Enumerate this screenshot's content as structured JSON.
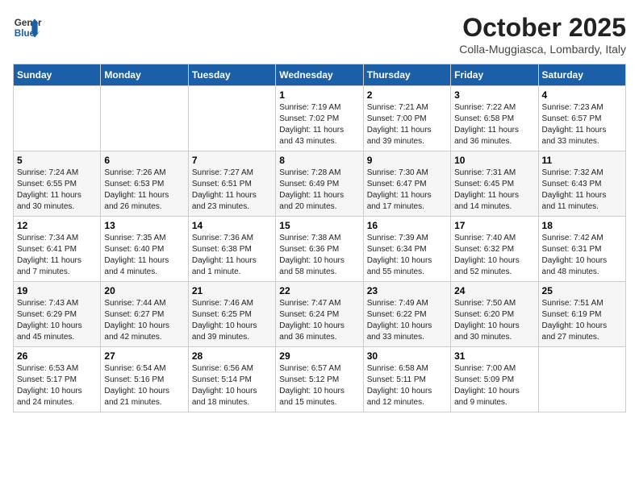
{
  "header": {
    "logo_line1": "General",
    "logo_line2": "Blue",
    "month": "October 2025",
    "location": "Colla-Muggiasca, Lombardy, Italy"
  },
  "weekdays": [
    "Sunday",
    "Monday",
    "Tuesday",
    "Wednesday",
    "Thursday",
    "Friday",
    "Saturday"
  ],
  "weeks": [
    [
      {
        "day": "",
        "info": ""
      },
      {
        "day": "",
        "info": ""
      },
      {
        "day": "",
        "info": ""
      },
      {
        "day": "1",
        "info": "Sunrise: 7:19 AM\nSunset: 7:02 PM\nDaylight: 11 hours\nand 43 minutes."
      },
      {
        "day": "2",
        "info": "Sunrise: 7:21 AM\nSunset: 7:00 PM\nDaylight: 11 hours\nand 39 minutes."
      },
      {
        "day": "3",
        "info": "Sunrise: 7:22 AM\nSunset: 6:58 PM\nDaylight: 11 hours\nand 36 minutes."
      },
      {
        "day": "4",
        "info": "Sunrise: 7:23 AM\nSunset: 6:57 PM\nDaylight: 11 hours\nand 33 minutes."
      }
    ],
    [
      {
        "day": "5",
        "info": "Sunrise: 7:24 AM\nSunset: 6:55 PM\nDaylight: 11 hours\nand 30 minutes."
      },
      {
        "day": "6",
        "info": "Sunrise: 7:26 AM\nSunset: 6:53 PM\nDaylight: 11 hours\nand 26 minutes."
      },
      {
        "day": "7",
        "info": "Sunrise: 7:27 AM\nSunset: 6:51 PM\nDaylight: 11 hours\nand 23 minutes."
      },
      {
        "day": "8",
        "info": "Sunrise: 7:28 AM\nSunset: 6:49 PM\nDaylight: 11 hours\nand 20 minutes."
      },
      {
        "day": "9",
        "info": "Sunrise: 7:30 AM\nSunset: 6:47 PM\nDaylight: 11 hours\nand 17 minutes."
      },
      {
        "day": "10",
        "info": "Sunrise: 7:31 AM\nSunset: 6:45 PM\nDaylight: 11 hours\nand 14 minutes."
      },
      {
        "day": "11",
        "info": "Sunrise: 7:32 AM\nSunset: 6:43 PM\nDaylight: 11 hours\nand 11 minutes."
      }
    ],
    [
      {
        "day": "12",
        "info": "Sunrise: 7:34 AM\nSunset: 6:41 PM\nDaylight: 11 hours\nand 7 minutes."
      },
      {
        "day": "13",
        "info": "Sunrise: 7:35 AM\nSunset: 6:40 PM\nDaylight: 11 hours\nand 4 minutes."
      },
      {
        "day": "14",
        "info": "Sunrise: 7:36 AM\nSunset: 6:38 PM\nDaylight: 11 hours\nand 1 minute."
      },
      {
        "day": "15",
        "info": "Sunrise: 7:38 AM\nSunset: 6:36 PM\nDaylight: 10 hours\nand 58 minutes."
      },
      {
        "day": "16",
        "info": "Sunrise: 7:39 AM\nSunset: 6:34 PM\nDaylight: 10 hours\nand 55 minutes."
      },
      {
        "day": "17",
        "info": "Sunrise: 7:40 AM\nSunset: 6:32 PM\nDaylight: 10 hours\nand 52 minutes."
      },
      {
        "day": "18",
        "info": "Sunrise: 7:42 AM\nSunset: 6:31 PM\nDaylight: 10 hours\nand 48 minutes."
      }
    ],
    [
      {
        "day": "19",
        "info": "Sunrise: 7:43 AM\nSunset: 6:29 PM\nDaylight: 10 hours\nand 45 minutes."
      },
      {
        "day": "20",
        "info": "Sunrise: 7:44 AM\nSunset: 6:27 PM\nDaylight: 10 hours\nand 42 minutes."
      },
      {
        "day": "21",
        "info": "Sunrise: 7:46 AM\nSunset: 6:25 PM\nDaylight: 10 hours\nand 39 minutes."
      },
      {
        "day": "22",
        "info": "Sunrise: 7:47 AM\nSunset: 6:24 PM\nDaylight: 10 hours\nand 36 minutes."
      },
      {
        "day": "23",
        "info": "Sunrise: 7:49 AM\nSunset: 6:22 PM\nDaylight: 10 hours\nand 33 minutes."
      },
      {
        "day": "24",
        "info": "Sunrise: 7:50 AM\nSunset: 6:20 PM\nDaylight: 10 hours\nand 30 minutes."
      },
      {
        "day": "25",
        "info": "Sunrise: 7:51 AM\nSunset: 6:19 PM\nDaylight: 10 hours\nand 27 minutes."
      }
    ],
    [
      {
        "day": "26",
        "info": "Sunrise: 6:53 AM\nSunset: 5:17 PM\nDaylight: 10 hours\nand 24 minutes."
      },
      {
        "day": "27",
        "info": "Sunrise: 6:54 AM\nSunset: 5:16 PM\nDaylight: 10 hours\nand 21 minutes."
      },
      {
        "day": "28",
        "info": "Sunrise: 6:56 AM\nSunset: 5:14 PM\nDaylight: 10 hours\nand 18 minutes."
      },
      {
        "day": "29",
        "info": "Sunrise: 6:57 AM\nSunset: 5:12 PM\nDaylight: 10 hours\nand 15 minutes."
      },
      {
        "day": "30",
        "info": "Sunrise: 6:58 AM\nSunset: 5:11 PM\nDaylight: 10 hours\nand 12 minutes."
      },
      {
        "day": "31",
        "info": "Sunrise: 7:00 AM\nSunset: 5:09 PM\nDaylight: 10 hours\nand 9 minutes."
      },
      {
        "day": "",
        "info": ""
      }
    ]
  ]
}
